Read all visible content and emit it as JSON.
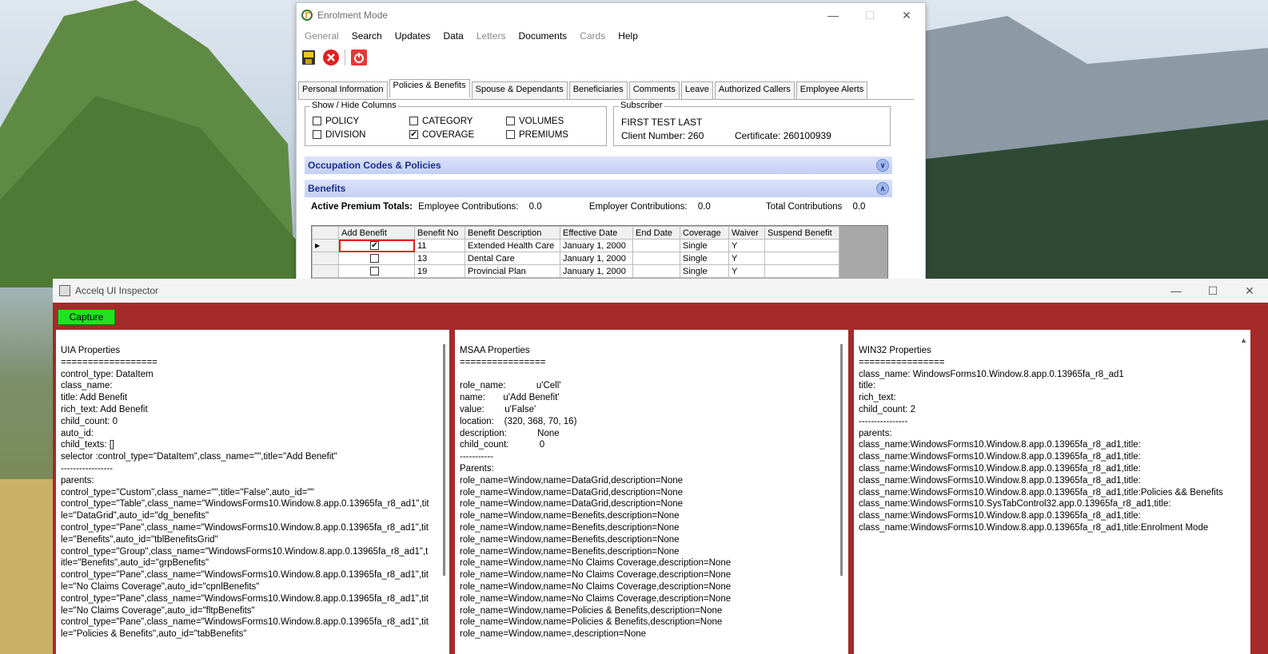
{
  "enrolment": {
    "title": "Enrolment Mode",
    "menu": [
      {
        "label": "General",
        "enabled": false
      },
      {
        "label": "Search",
        "enabled": true
      },
      {
        "label": "Updates",
        "enabled": true
      },
      {
        "label": "Data",
        "enabled": true
      },
      {
        "label": "Letters",
        "enabled": false
      },
      {
        "label": "Documents",
        "enabled": true
      },
      {
        "label": "Cards",
        "enabled": false
      },
      {
        "label": "Help",
        "enabled": true
      }
    ],
    "tabs": [
      "Personal Information",
      "Policies & Benefits",
      "Spouse & Dependants",
      "Beneficiaries",
      "Comments",
      "Leave",
      "Authorized Callers",
      "Employee Alerts"
    ],
    "active_tab": "Policies & Benefits",
    "show_hide": {
      "legend": "Show / Hide Columns",
      "options": [
        {
          "label": "POLICY",
          "checked": false
        },
        {
          "label": "CATEGORY",
          "checked": false
        },
        {
          "label": "VOLUMES",
          "checked": false
        },
        {
          "label": "DIVISION",
          "checked": false
        },
        {
          "label": "COVERAGE",
          "checked": true
        },
        {
          "label": "PREMIUMS",
          "checked": false
        }
      ]
    },
    "subscriber": {
      "legend": "Subscriber",
      "name": "FIRST TEST LAST",
      "client_label": "Client Number:",
      "client_number": "260",
      "cert_label": "Certificate:",
      "certificate": "260100939"
    },
    "occupation_header": "Occupation Codes & Policies",
    "benefits_header": "Benefits",
    "totals": {
      "label": "Active Premium Totals:",
      "employee_label": "Employee Contributions:",
      "employee": "0.0",
      "employer_label": "Employer Contributions:",
      "employer": "0.0",
      "total_label": "Total Contributions",
      "total": "0.0"
    },
    "grid": {
      "columns": [
        "Add Benefit",
        "Benefit No",
        "Benefit Description",
        "Effective Date",
        "End Date",
        "Coverage",
        "Waiver",
        "Suspend Benefit"
      ],
      "rows": [
        {
          "checked": true,
          "no": "11",
          "desc": "Extended Health Care",
          "eff": "January 1, 2000",
          "end": "",
          "cov": "Single",
          "waiver": "Y",
          "suspend": ""
        },
        {
          "checked": false,
          "no": "13",
          "desc": "Dental Care",
          "eff": "January 1, 2000",
          "end": "",
          "cov": "Single",
          "waiver": "Y",
          "suspend": ""
        },
        {
          "checked": false,
          "no": "19",
          "desc": "Provincial Plan",
          "eff": "January 1, 2000",
          "end": "",
          "cov": "Single",
          "waiver": "Y",
          "suspend": ""
        }
      ]
    }
  },
  "inspector": {
    "title": "Accelq UI Inspector",
    "capture_label": "Capture",
    "uia": "UIA Properties\n==================\ncontrol_type: DataItem\nclass_name:\ntitle: Add Benefit\nrich_text: Add Benefit\nchild_count: 0\nauto_id:\nchild_texts: []\nselector :control_type=\"DataItem\",class_name=\"\",title=\"Add Benefit\"\n-----------------\nparents:\ncontrol_type=\"Custom\",class_name=\"\",title=\"False\",auto_id=\"\"\ncontrol_type=\"Table\",class_name=\"WindowsForms10.Window.8.app.0.13965fa_r8_ad1\",tit\nle=\"DataGrid\",auto_id=\"dg_benefits\"\ncontrol_type=\"Pane\",class_name=\"WindowsForms10.Window.8.app.0.13965fa_r8_ad1\",tit\nle=\"Benefits\",auto_id=\"tblBenefitsGrid\"\ncontrol_type=\"Group\",class_name=\"WindowsForms10.Window.8.app.0.13965fa_r8_ad1\",t\nitle=\"Benefits\",auto_id=\"grpBenefits\"\ncontrol_type=\"Pane\",class_name=\"WindowsForms10.Window.8.app.0.13965fa_r8_ad1\",tit\nle=\"No Claims Coverage\",auto_id=\"cpnlBenefits\"\ncontrol_type=\"Pane\",class_name=\"WindowsForms10.Window.8.app.0.13965fa_r8_ad1\",tit\nle=\"No Claims Coverage\",auto_id=\"fltpBenefits\"\ncontrol_type=\"Pane\",class_name=\"WindowsForms10.Window.8.app.0.13965fa_r8_ad1\",tit\nle=\"Policies & Benefits\",auto_id=\"tabBenefits\"",
    "msaa": "MSAA Properties\n================\n\nrole_name:            u'Cell'\nname:       u'Add Benefit'\nvalue:        u'False'\nlocation:    (320, 368, 70, 16)\ndescription:            None\nchild_count:            0\n-----------\nParents:\nrole_name=Window,name=DataGrid,description=None\nrole_name=Window,name=DataGrid,description=None\nrole_name=Window,name=DataGrid,description=None\nrole_name=Window,name=Benefits,description=None\nrole_name=Window,name=Benefits,description=None\nrole_name=Window,name=Benefits,description=None\nrole_name=Window,name=Benefits,description=None\nrole_name=Window,name=No Claims Coverage,description=None\nrole_name=Window,name=No Claims Coverage,description=None\nrole_name=Window,name=No Claims Coverage,description=None\nrole_name=Window,name=No Claims Coverage,description=None\nrole_name=Window,name=Policies & Benefits,description=None\nrole_name=Window,name=Policies & Benefits,description=None\nrole_name=Window,name=,description=None",
    "win32": "WIN32 Properties\n================\nclass_name: WindowsForms10.Window.8.app.0.13965fa_r8_ad1\ntitle:\nrich_text:\nchild_count: 2\n----------------\nparents:\nclass_name:WindowsForms10.Window.8.app.0.13965fa_r8_ad1,title:\nclass_name:WindowsForms10.Window.8.app.0.13965fa_r8_ad1,title:\nclass_name:WindowsForms10.Window.8.app.0.13965fa_r8_ad1,title:\nclass_name:WindowsForms10.Window.8.app.0.13965fa_r8_ad1,title:\nclass_name:WindowsForms10.Window.8.app.0.13965fa_r8_ad1,title:Policies && Benefits\nclass_name:WindowsForms10.SysTabControl32.app.0.13965fa_r8_ad1,title:\nclass_name:WindowsForms10.Window.8.app.0.13965fa_r8_ad1,title:\nclass_name:WindowsForms10.Window.8.app.0.13965fa_r8_ad1,title:Enrolment Mode"
  },
  "colors": {
    "inspector_bg": "#a52a2a",
    "capture_bg": "#21e121",
    "section_text": "#1a2e8c"
  }
}
